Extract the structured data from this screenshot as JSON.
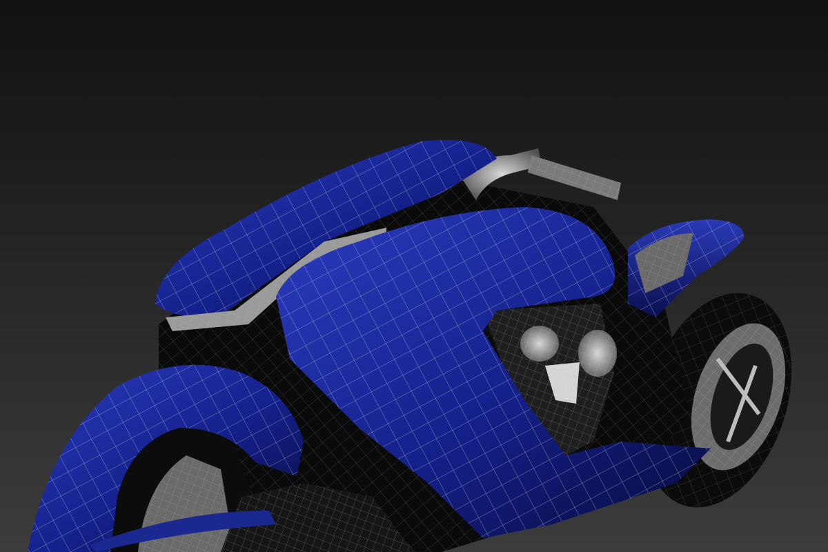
{
  "viewport": {
    "background_top": "#111111",
    "background_bottom": "#3c3c3c"
  },
  "model": {
    "subject": "motorcycle-wireframe",
    "body_color": "#14208a",
    "body_highlight": "#2c3cc0",
    "body_shadow": "#070b3a",
    "frame_color": "#0a0a0a",
    "chrome_color": "#8a8a8a",
    "wire_color": "#c8cce0"
  }
}
